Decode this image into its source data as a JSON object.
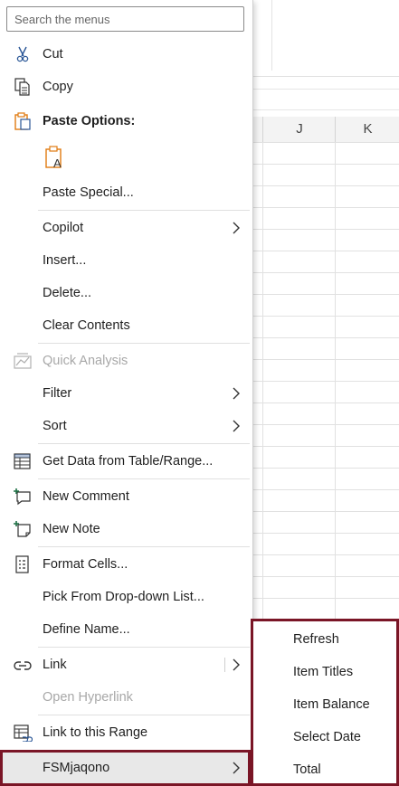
{
  "columns": [
    "J",
    "K"
  ],
  "search": {
    "placeholder": "Search the menus"
  },
  "menu": {
    "cut": "Cut",
    "copy": "Copy",
    "paste_options": "Paste Options:",
    "paste_special": "Paste Special...",
    "copilot": "Copilot",
    "insert": "Insert...",
    "delete": "Delete...",
    "clear_contents": "Clear Contents",
    "quick_analysis": "Quick Analysis",
    "filter": "Filter",
    "sort": "Sort",
    "get_data": "Get Data from Table/Range...",
    "new_comment": "New Comment",
    "new_note": "New Note",
    "format_cells": "Format Cells...",
    "pick_from_list": "Pick From Drop-down List...",
    "define_name": "Define Name...",
    "link": "Link",
    "open_hyperlink": "Open Hyperlink",
    "link_to_range": "Link to this Range",
    "fsm": "FSMjaqono"
  },
  "submenu": {
    "items": [
      "Refresh",
      "Item Titles",
      "Item Balance",
      "Select Date",
      "Total"
    ]
  },
  "colors": {
    "accent_outline": "#7a1526",
    "icon_blue": "#2b5797",
    "icon_orange": "#e07a10",
    "icon_green": "#1e7145"
  }
}
